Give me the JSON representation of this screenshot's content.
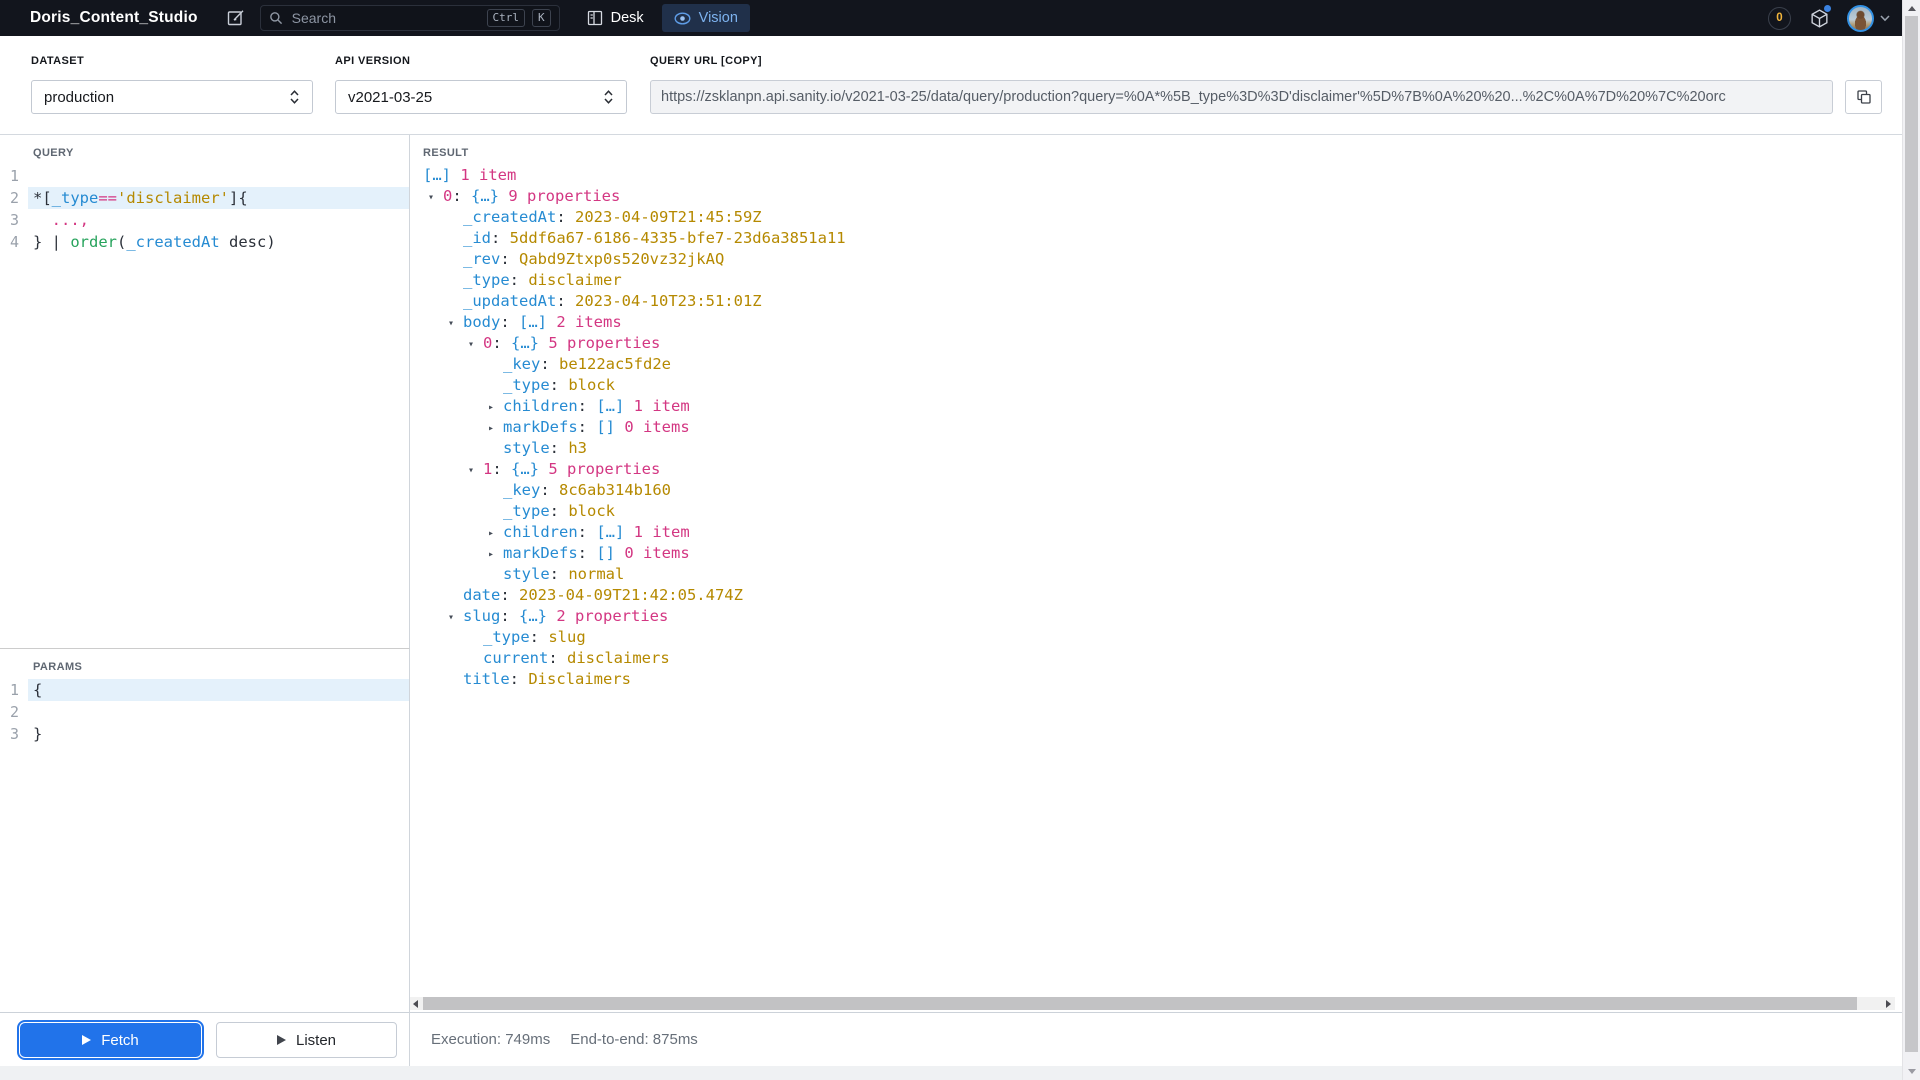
{
  "header": {
    "title": "Doris_Content_Studio",
    "search": {
      "placeholder": "Search",
      "keys": [
        "Ctrl",
        "K"
      ]
    },
    "tabs": {
      "desk": "Desk",
      "vision": "Vision"
    },
    "badge_count": "0"
  },
  "controls": {
    "dataset_label": "DATASET",
    "dataset_value": "production",
    "api_version_label": "API VERSION",
    "api_version_value": "v2021-03-25",
    "query_url_label": "QUERY URL [COPY]",
    "query_url_value": "https://zsklanpn.api.sanity.io/v2021-03-25/data/query/production?query=%0A*%5B_type%3D%3D'disclaimer'%5D%7B%0A%20%20...%2C%0A%7D%20%7C%20orc"
  },
  "query_editor": {
    "label": "QUERY",
    "lines": [
      {
        "num": "1",
        "active": false,
        "tokens": []
      },
      {
        "num": "2",
        "active": true,
        "tokens": [
          [
            "pln",
            "*["
          ],
          [
            "key",
            "_type"
          ],
          [
            "op",
            "=="
          ],
          [
            "str",
            "'disclaimer'"
          ],
          [
            "pln",
            "]{"
          ]
        ]
      },
      {
        "num": "3",
        "active": false,
        "tokens": [
          [
            "pln",
            "  "
          ],
          [
            "op",
            "...,"
          ]
        ]
      },
      {
        "num": "4",
        "active": false,
        "tokens": [
          [
            "pln",
            "} | "
          ],
          [
            "fn",
            "order"
          ],
          [
            "pln",
            "("
          ],
          [
            "key",
            "_createdAt"
          ],
          [
            "pln",
            " desc)"
          ]
        ]
      }
    ]
  },
  "params_editor": {
    "label": "PARAMS",
    "lines": [
      {
        "num": "1",
        "active": true,
        "tokens": [
          [
            "pln",
            "{"
          ]
        ]
      },
      {
        "num": "2",
        "active": false,
        "tokens": []
      },
      {
        "num": "3",
        "active": false,
        "tokens": [
          [
            "pln",
            "}"
          ]
        ]
      }
    ]
  },
  "result": {
    "label": "RESULT",
    "lines": [
      {
        "i": 0,
        "a": "",
        "s": [
          [
            "brk",
            "[…]"
          ],
          [
            "cnt",
            " 1 item"
          ]
        ]
      },
      {
        "i": 1,
        "a": "d",
        "s": [
          [
            "idx",
            "0"
          ],
          [
            "pln",
            ": "
          ],
          [
            "brk",
            "{…}"
          ],
          [
            "cnt",
            " 9 properties"
          ]
        ]
      },
      {
        "i": 2,
        "a": "",
        "s": [
          [
            "key",
            "_createdAt"
          ],
          [
            "pln",
            ": "
          ],
          [
            "val",
            "2023-04-09T21:45:59Z"
          ]
        ]
      },
      {
        "i": 2,
        "a": "",
        "s": [
          [
            "key",
            "_id"
          ],
          [
            "pln",
            ": "
          ],
          [
            "val",
            "5ddf6a67-6186-4335-bfe7-23d6a3851a11"
          ]
        ]
      },
      {
        "i": 2,
        "a": "",
        "s": [
          [
            "key",
            "_rev"
          ],
          [
            "pln",
            ": "
          ],
          [
            "val",
            "Qabd9Ztxp0s520vz32jkAQ"
          ]
        ]
      },
      {
        "i": 2,
        "a": "",
        "s": [
          [
            "key",
            "_type"
          ],
          [
            "pln",
            ": "
          ],
          [
            "val",
            "disclaimer"
          ]
        ]
      },
      {
        "i": 2,
        "a": "",
        "s": [
          [
            "key",
            "_updatedAt"
          ],
          [
            "pln",
            ": "
          ],
          [
            "val",
            "2023-04-10T23:51:01Z"
          ]
        ]
      },
      {
        "i": 2,
        "a": "d",
        "s": [
          [
            "key",
            "body"
          ],
          [
            "pln",
            ": "
          ],
          [
            "brk",
            "[…]"
          ],
          [
            "cnt",
            " 2 items"
          ]
        ]
      },
      {
        "i": 3,
        "a": "d",
        "s": [
          [
            "idx",
            "0"
          ],
          [
            "pln",
            ": "
          ],
          [
            "brk",
            "{…}"
          ],
          [
            "cnt",
            " 5 properties"
          ]
        ]
      },
      {
        "i": 4,
        "a": "",
        "s": [
          [
            "key",
            "_key"
          ],
          [
            "pln",
            ": "
          ],
          [
            "val",
            "be122ac5fd2e"
          ]
        ]
      },
      {
        "i": 4,
        "a": "",
        "s": [
          [
            "key",
            "_type"
          ],
          [
            "pln",
            ": "
          ],
          [
            "val",
            "block"
          ]
        ]
      },
      {
        "i": 4,
        "a": "r",
        "s": [
          [
            "key",
            "children"
          ],
          [
            "pln",
            ": "
          ],
          [
            "brk",
            "[…]"
          ],
          [
            "cnt",
            " 1 item"
          ]
        ]
      },
      {
        "i": 4,
        "a": "r",
        "s": [
          [
            "key",
            "markDefs"
          ],
          [
            "pln",
            ": "
          ],
          [
            "brk",
            "[]"
          ],
          [
            "cnt",
            " 0 items"
          ]
        ]
      },
      {
        "i": 4,
        "a": "",
        "s": [
          [
            "key",
            "style"
          ],
          [
            "pln",
            ": "
          ],
          [
            "val",
            "h3"
          ]
        ]
      },
      {
        "i": 3,
        "a": "d",
        "s": [
          [
            "idx",
            "1"
          ],
          [
            "pln",
            ": "
          ],
          [
            "brk",
            "{…}"
          ],
          [
            "cnt",
            " 5 properties"
          ]
        ]
      },
      {
        "i": 4,
        "a": "",
        "s": [
          [
            "key",
            "_key"
          ],
          [
            "pln",
            ": "
          ],
          [
            "val",
            "8c6ab314b160"
          ]
        ]
      },
      {
        "i": 4,
        "a": "",
        "s": [
          [
            "key",
            "_type"
          ],
          [
            "pln",
            ": "
          ],
          [
            "val",
            "block"
          ]
        ]
      },
      {
        "i": 4,
        "a": "r",
        "s": [
          [
            "key",
            "children"
          ],
          [
            "pln",
            ": "
          ],
          [
            "brk",
            "[…]"
          ],
          [
            "cnt",
            " 1 item"
          ]
        ]
      },
      {
        "i": 4,
        "a": "r",
        "s": [
          [
            "key",
            "markDefs"
          ],
          [
            "pln",
            ": "
          ],
          [
            "brk",
            "[]"
          ],
          [
            "cnt",
            " 0 items"
          ]
        ]
      },
      {
        "i": 4,
        "a": "",
        "s": [
          [
            "key",
            "style"
          ],
          [
            "pln",
            ": "
          ],
          [
            "val",
            "normal"
          ]
        ]
      },
      {
        "i": 2,
        "a": "",
        "s": [
          [
            "key",
            "date"
          ],
          [
            "pln",
            ": "
          ],
          [
            "val",
            "2023-04-09T21:42:05.474Z"
          ]
        ]
      },
      {
        "i": 2,
        "a": "d",
        "s": [
          [
            "key",
            "slug"
          ],
          [
            "pln",
            ": "
          ],
          [
            "brk",
            "{…}"
          ],
          [
            "cnt",
            " 2 properties"
          ]
        ]
      },
      {
        "i": 3,
        "a": "",
        "s": [
          [
            "key",
            "_type"
          ],
          [
            "pln",
            ": "
          ],
          [
            "val",
            "slug"
          ]
        ]
      },
      {
        "i": 3,
        "a": "",
        "s": [
          [
            "key",
            "current"
          ],
          [
            "pln",
            ": "
          ],
          [
            "val",
            "disclaimers"
          ]
        ]
      },
      {
        "i": 2,
        "a": "",
        "s": [
          [
            "key",
            "title"
          ],
          [
            "pln",
            ": "
          ],
          [
            "val",
            "Disclaimers"
          ]
        ]
      }
    ]
  },
  "footer": {
    "fetch": "Fetch",
    "listen": "Listen",
    "execution": "Execution: 749ms",
    "end_to_end": "End-to-end: 875ms"
  },
  "icons": {
    "collapse": "▾",
    "expand": "▸",
    "names": [
      "compose-icon",
      "search-icon",
      "desk-icon",
      "eye-icon",
      "package-icon",
      "avatar",
      "chevron-down-icon",
      "copy-icon",
      "select-chevrons-icon",
      "play-icon"
    ]
  },
  "colors": {
    "header_bg": "#12151d",
    "vision_tab_bg": "#20304a",
    "vision_tab_text": "#7db2ee",
    "badge_text": "#f3b63c",
    "accent_blue": "#2173ea",
    "json_key": "#268bd2",
    "json_count": "#d33682",
    "json_string": "#b58900",
    "groq_function": "#27a35c",
    "active_line_bg": "#e4f1fb"
  }
}
